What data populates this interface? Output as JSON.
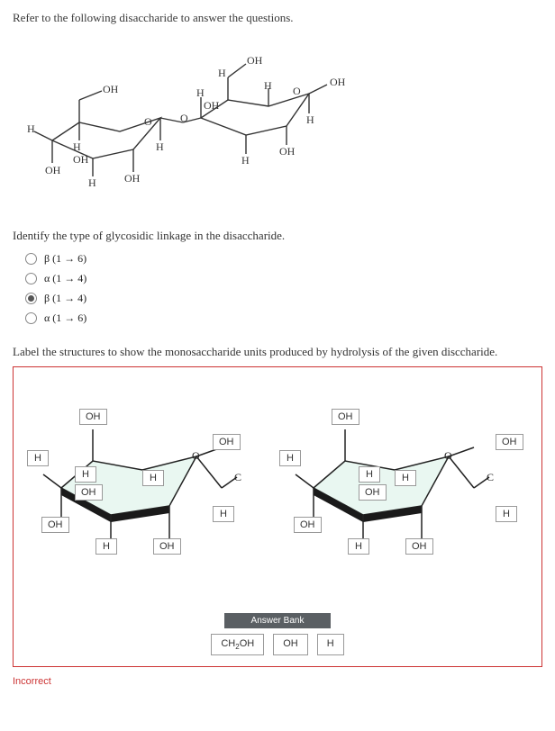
{
  "intro": "Refer to the following disaccharide to answer the questions.",
  "mol_labels": {
    "L": {
      "top_oh": "OH",
      "left_h_top": "H",
      "left_oh": "OH",
      "left_h_in": "H",
      "lower_oh_l": "OH",
      "axial_h": "H",
      "bottom_h": "H",
      "bottom_oh": "OH",
      "right_h_bot": "H",
      "link_o": "O"
    },
    "R": {
      "ch2_oh": "OH",
      "top_o": "O",
      "top_h_a": "H",
      "top_h_b": "H",
      "c2_oh": "OH",
      "h_mid": "H",
      "bot_h": "H",
      "bot_oh": "OH",
      "far_h": "H",
      "far_oh": "OH"
    }
  },
  "q1": "Identify the type of glycosidic linkage in the disaccharide.",
  "options": [
    {
      "label": "β (1 → 6)",
      "selected": false
    },
    {
      "label": "α (1 → 4)",
      "selected": false
    },
    {
      "label": "β (1 → 4)",
      "selected": true
    },
    {
      "label": "α (1 → 6)",
      "selected": false
    }
  ],
  "q2": "Label the structures to show the monosaccharide units produced by hydrolysis of the given disccharide.",
  "placed_left": {
    "top": "OH",
    "left_out": "H",
    "upper_in_h": "H",
    "upper_in_oh": "OH",
    "mid_h": "H",
    "lower_out": "OH",
    "lower_in_h": "H",
    "lower_in_oh": "OH",
    "right_up": "OH",
    "right_dn": "H"
  },
  "placed_right": {
    "top": "OH",
    "left_out": "H",
    "upper_in_h": "H",
    "upper_in_oh": "OH",
    "mid_h": "H",
    "lower_out": "OH",
    "lower_in_h": "H",
    "lower_in_oh": "OH",
    "right_up": "OH",
    "right_dn": "H"
  },
  "bank_title": "Answer Bank",
  "bank_items": [
    "CH₂OH",
    "OH",
    "H"
  ],
  "incorrect": "Incorrect"
}
